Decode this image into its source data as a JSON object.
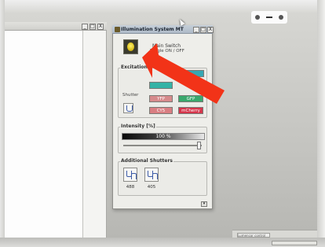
{
  "window": {
    "title": "Illumination System MT",
    "buttons": [
      "_",
      "□",
      "X"
    ]
  },
  "background_window": {
    "buttons": [
      "_",
      "□",
      "X"
    ]
  },
  "main_switch": {
    "label": "Main Switch",
    "sublabel": "Toggle ON / OFF"
  },
  "excitation": {
    "label": "Excitation",
    "filters": [
      {
        "label": "",
        "color": "#36a7b3"
      },
      {
        "label": "",
        "color": "#34b3a6"
      },
      {
        "label": "YFP",
        "color": "#d68a8c"
      },
      {
        "label": "GFP",
        "color": "#3aa86d"
      },
      {
        "label": "CY5",
        "color": "#d97e82"
      },
      {
        "label": "mCherry",
        "color": "#d5364c"
      }
    ],
    "shutter_label": "Shutter"
  },
  "intensity": {
    "label": "Intensity [%]",
    "value_text": "100 %",
    "value": 100
  },
  "additional_shutters": {
    "label": "Additional Shutters",
    "items": [
      {
        "label": "488"
      },
      {
        "label": "405"
      }
    ]
  },
  "taskbar": {
    "item_label": "Lumencor control"
  },
  "colors": {
    "arrow": "#f23318",
    "title_bar": "#aebac8"
  }
}
